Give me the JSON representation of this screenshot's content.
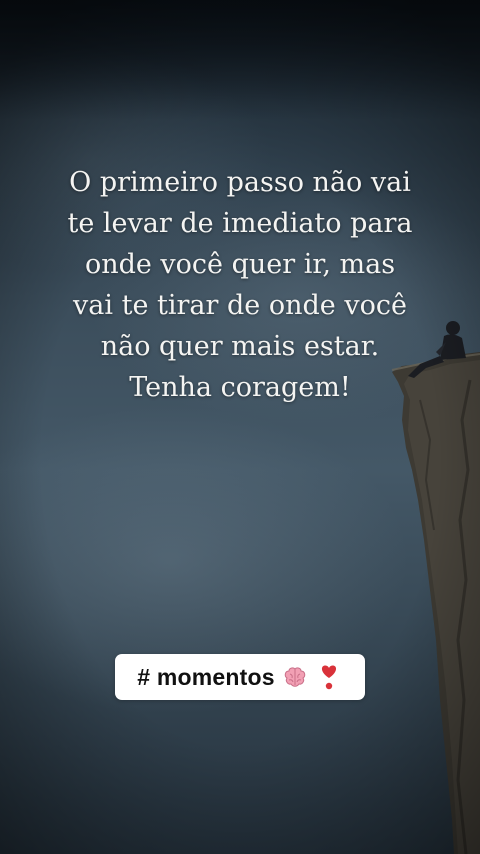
{
  "quote": {
    "lines": [
      "O primeiro passo não vai",
      "te levar de imediato para",
      "onde você quer ir, mas",
      "vai te tirar de onde você",
      "não quer mais estar.",
      "Tenha coragem!"
    ]
  },
  "hashtag": {
    "text": "# momentos",
    "icons": [
      "brain-emoji",
      "heart-exclamation-emoji"
    ]
  },
  "colors": {
    "sky_dark": "#16202a",
    "sky_mid": "#445867",
    "text": "#f4f4f2",
    "tag_bg": "#ffffff",
    "heart": "#d9323a",
    "brain": "#f2a0b4"
  }
}
